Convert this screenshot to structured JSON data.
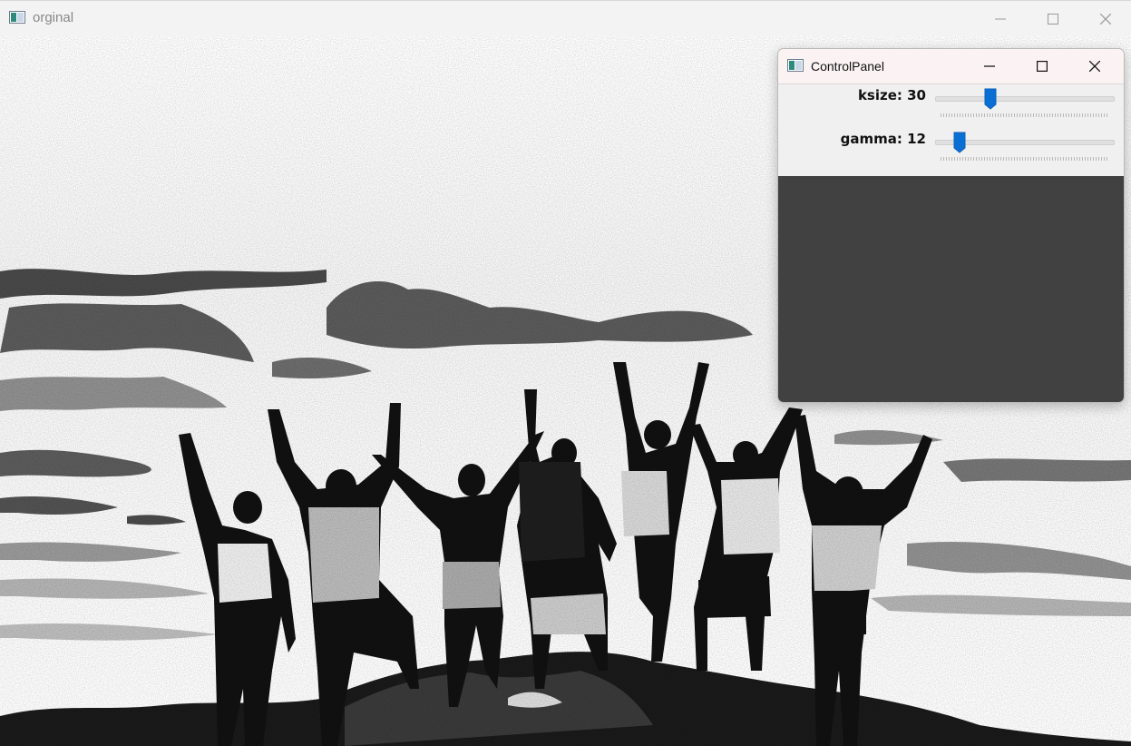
{
  "main_window": {
    "title": "orginal",
    "icon": "window-app-icon",
    "controls": [
      "minimize-icon",
      "maximize-icon",
      "close-icon"
    ]
  },
  "control_panel": {
    "title": "ControlPanel",
    "icon": "window-app-icon",
    "controls": [
      "minimize-icon",
      "maximize-icon",
      "close-icon"
    ],
    "sliders": [
      {
        "label": "ksize: 30",
        "name": "ksize",
        "value": 30,
        "position_fraction": 0.31
      },
      {
        "label": "gamma: 12",
        "name": "gamma",
        "value": 12,
        "position_fraction": 0.14
      }
    ],
    "canvas_color": "#414141"
  },
  "colors": {
    "accent": "#0a6fd4",
    "titlebar_bg": "#f3f3f3",
    "panel_titlebar_bg": "#fbf2f4"
  }
}
